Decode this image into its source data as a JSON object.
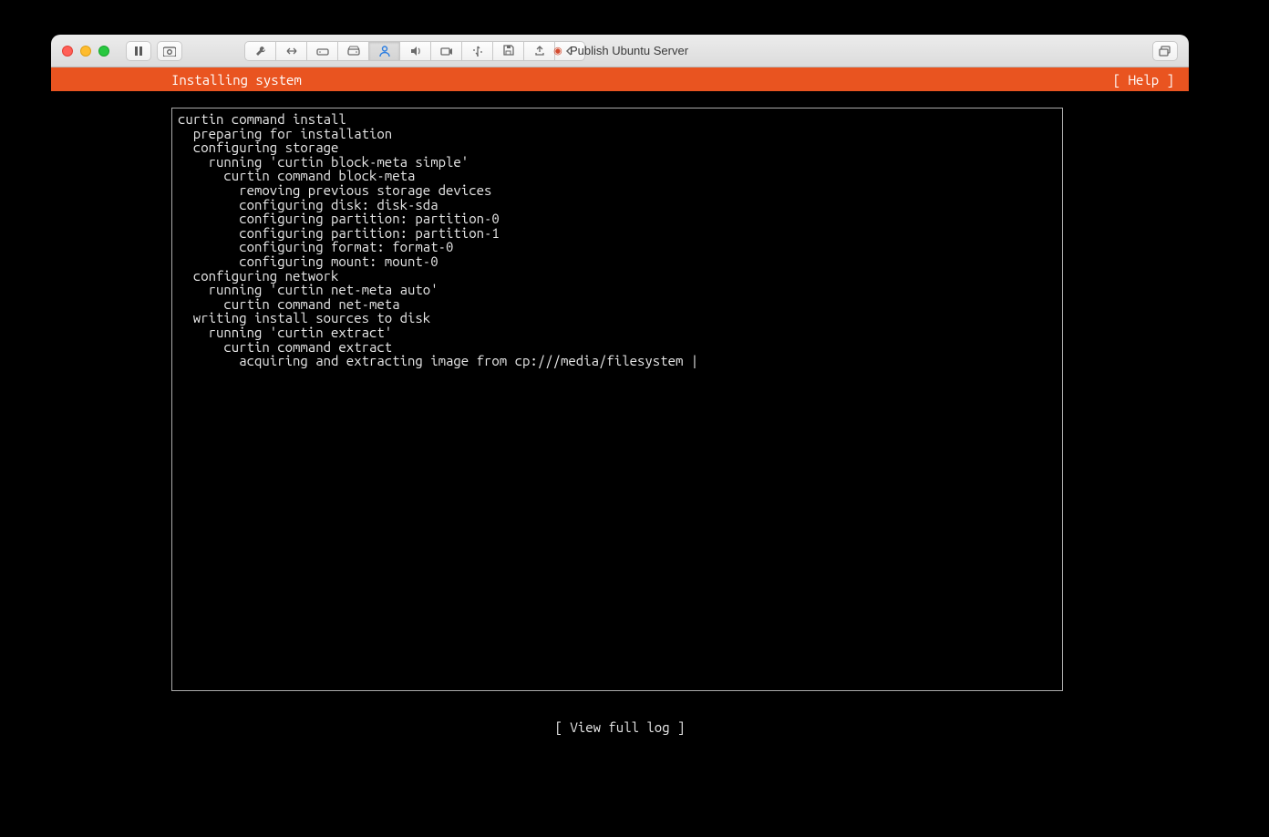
{
  "window": {
    "title": "Publish Ubuntu Server"
  },
  "toolbar": {
    "icons": {
      "pause": "pause",
      "snapshot": "snapshot",
      "wrench": "settings",
      "resize": "resize",
      "hdd": "hdd",
      "hdd2": "hdd-ext",
      "user": "user",
      "sound": "sound",
      "camera": "camera",
      "usb": "usb",
      "floppy": "floppy",
      "share": "share",
      "chevron": "chevron",
      "stack": "stack"
    }
  },
  "installer": {
    "header": "Installing system",
    "help_label": "[ Help ]",
    "footer_label": "[ View full log ]",
    "log_lines": [
      {
        "indent": 0,
        "text": "curtin command install"
      },
      {
        "indent": 1,
        "text": "preparing for installation"
      },
      {
        "indent": 1,
        "text": "configuring storage"
      },
      {
        "indent": 2,
        "text": "running 'curtin block-meta simple'"
      },
      {
        "indent": 3,
        "text": "curtin command block-meta"
      },
      {
        "indent": 4,
        "text": "removing previous storage devices"
      },
      {
        "indent": 4,
        "text": "configuring disk: disk-sda"
      },
      {
        "indent": 4,
        "text": "configuring partition: partition-0"
      },
      {
        "indent": 4,
        "text": "configuring partition: partition-1"
      },
      {
        "indent": 4,
        "text": "configuring format: format-0"
      },
      {
        "indent": 4,
        "text": "configuring mount: mount-0"
      },
      {
        "indent": 1,
        "text": "configuring network"
      },
      {
        "indent": 2,
        "text": "running 'curtin net-meta auto'"
      },
      {
        "indent": 3,
        "text": "curtin command net-meta"
      },
      {
        "indent": 1,
        "text": "writing install sources to disk"
      },
      {
        "indent": 2,
        "text": "running 'curtin extract'"
      },
      {
        "indent": 3,
        "text": "curtin command extract"
      },
      {
        "indent": 4,
        "text": "acquiring and extracting image from cp:///media/filesystem |"
      }
    ]
  }
}
